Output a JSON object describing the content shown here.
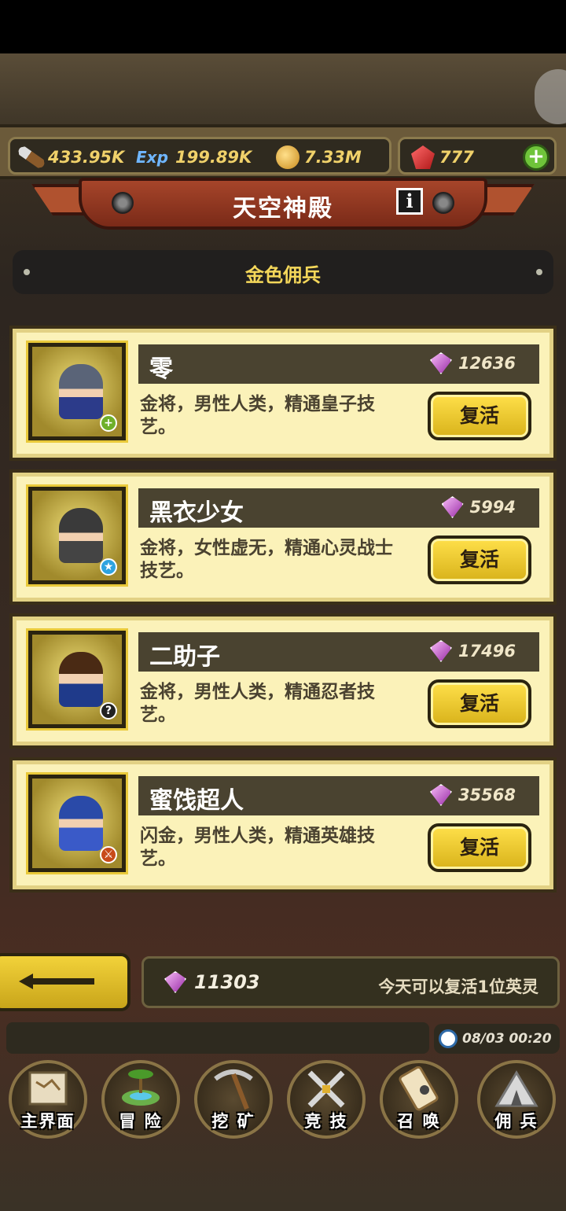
{
  "resources": {
    "attack": "433.95K",
    "exp_icon_text": "Exp",
    "exp": "199.89K",
    "gold": "7.33M",
    "rubies": "777",
    "add_symbol": "+"
  },
  "header": {
    "title": "天空神殿",
    "info_symbol": "i"
  },
  "section": {
    "title": "金色佣兵"
  },
  "heroes": [
    {
      "name": "零",
      "cost": "12636",
      "desc": "金将，男性人类，精通皇子技艺。",
      "button": "复活",
      "badge": "+",
      "badge_color": "#6fb02a",
      "hair_color": "#5a6478",
      "body_color": "#2c3b8a"
    },
    {
      "name": "黑衣少女",
      "cost": "5994",
      "desc": "金将，女性虚无，精通心灵战士技艺。",
      "button": "复活",
      "badge": "★",
      "badge_color": "#2ea3e0",
      "hair_color": "#3a3a3a",
      "body_color": "#444444"
    },
    {
      "name": "二助子",
      "cost": "17496",
      "desc": "金将，男性人类，精通忍者技艺。",
      "button": "复活",
      "badge": "?",
      "badge_color": "#222222",
      "hair_color": "#4a2a14",
      "body_color": "#1f3a8a"
    },
    {
      "name": "蜜饯超人",
      "cost": "35568",
      "desc": "闪金，男性人类，精通英雄技艺。",
      "button": "复活",
      "badge": "⚔",
      "badge_color": "#c84a1a",
      "hair_color": "#2a4aa8",
      "body_color": "#3a5ac8"
    }
  ],
  "footer": {
    "gems": "11303",
    "note": "今天可以复活1位英灵",
    "clock": "08/03 00:20"
  },
  "nav": [
    {
      "label": "主界面",
      "icon": "map-icon"
    },
    {
      "label": "冒 险",
      "icon": "island-icon"
    },
    {
      "label": "挖 矿",
      "icon": "pickaxe-icon"
    },
    {
      "label": "竞 技",
      "icon": "crossed-swords-icon"
    },
    {
      "label": "召 唤",
      "icon": "scroll-icon"
    },
    {
      "label": "佣 兵",
      "icon": "tent-icon"
    }
  ]
}
